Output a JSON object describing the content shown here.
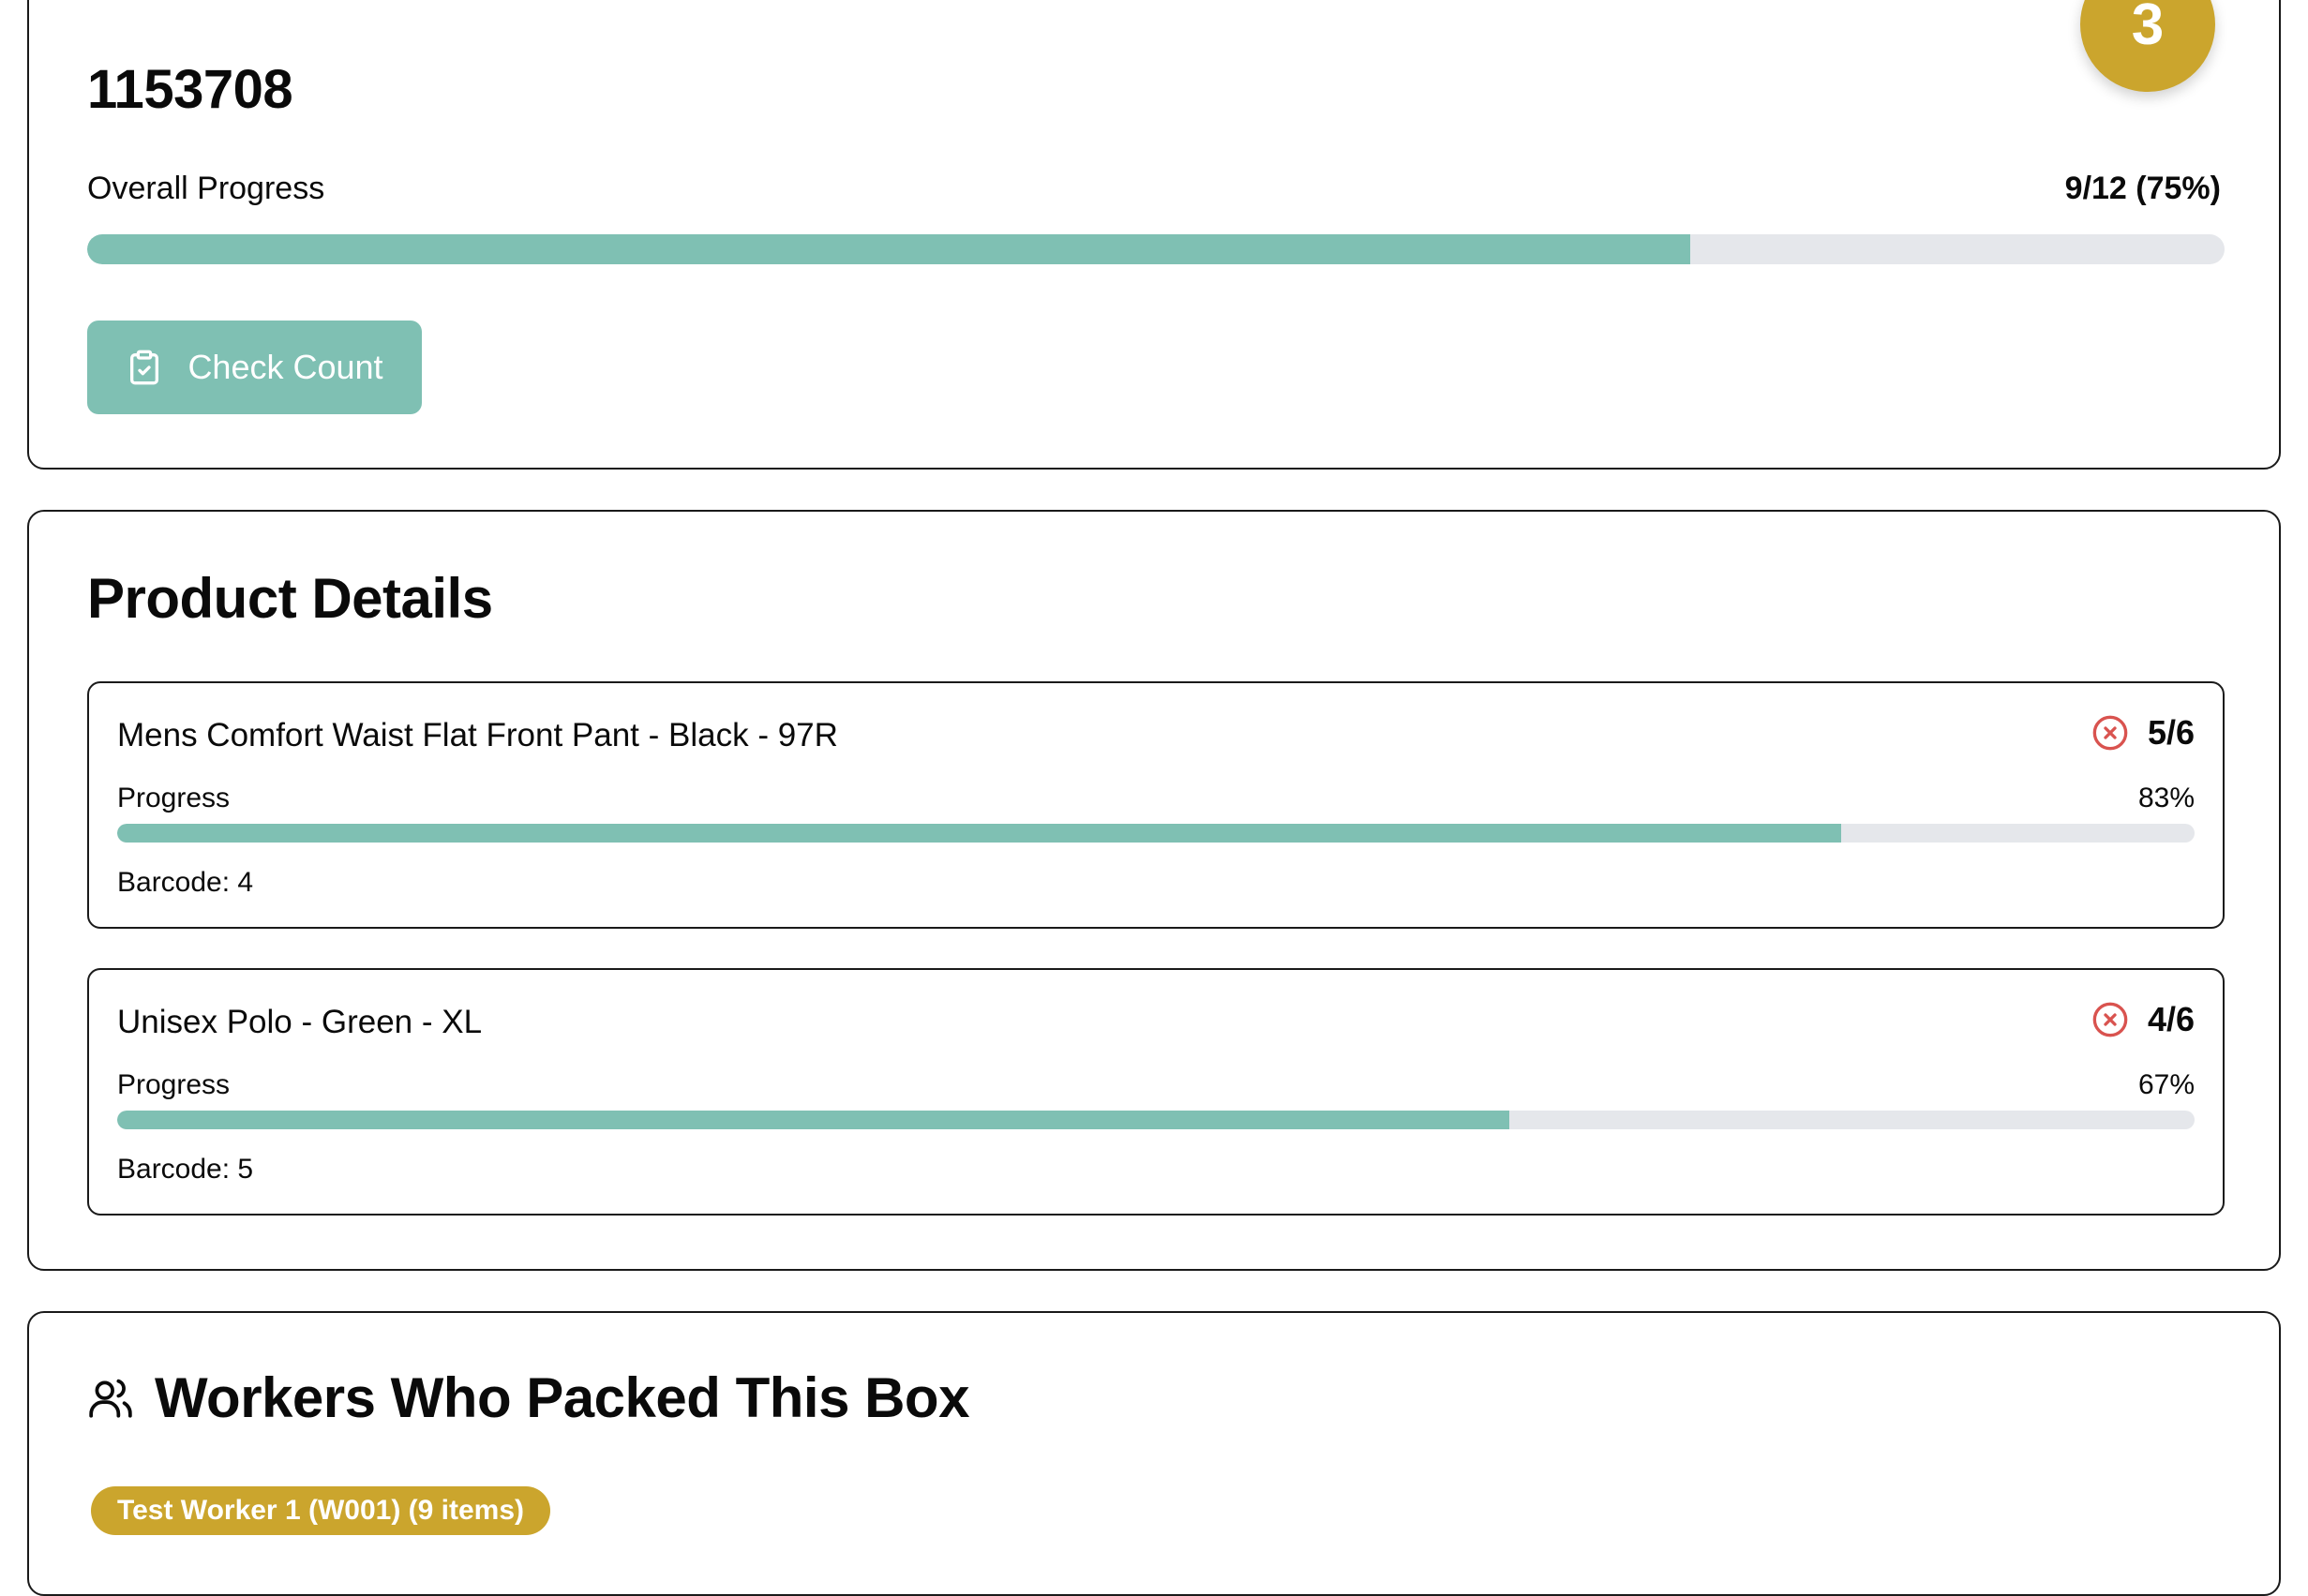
{
  "box": {
    "id": "1153708",
    "badge": "3",
    "overall_label": "Overall Progress",
    "overall_value": "9/12 (75%)",
    "overall_progress": 0.75,
    "check_button_label": "Check Count"
  },
  "products": {
    "title": "Product Details",
    "items": [
      {
        "name": "Mens Comfort Waist Flat Front Pant - Black - 97R",
        "count": "5/6",
        "progress_label": "Progress",
        "progress_pct": "83%",
        "progress": 0.83,
        "barcode": "Barcode: 4",
        "status_icon": "x-circle-icon"
      },
      {
        "name": "Unisex Polo - Green - XL",
        "count": "4/6",
        "progress_label": "Progress",
        "progress_pct": "67%",
        "progress": 0.67,
        "barcode": "Barcode: 5",
        "status_icon": "x-circle-icon"
      }
    ]
  },
  "workers": {
    "title": "Workers Who Packed This Box",
    "icon": "users-icon",
    "chips": [
      "Test Worker 1 (W001) (9 items)"
    ]
  },
  "colors": {
    "accent": "#7fc0b3",
    "gold": "#cba52d",
    "error": "#d9534f",
    "track": "#e5e7eb"
  }
}
